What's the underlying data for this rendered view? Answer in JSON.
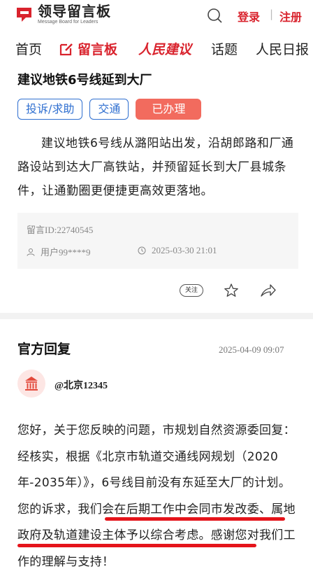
{
  "header": {
    "logo_cn": "领导留言板",
    "logo_en": "Message Board for Leaders",
    "login": "登录",
    "separator": "|",
    "register": "注册"
  },
  "nav": {
    "items": [
      "首页",
      "留言板",
      "人民建议",
      "话题",
      "人民日报"
    ]
  },
  "post": {
    "title": "建议地铁6号线延到大厂",
    "tags": [
      "投诉/求助",
      "交通"
    ],
    "status": "已办理",
    "body": "建议地铁6号线从潞阳站出发，沿胡郎路和厂通路设站到达大厂高铁站，并预留延长到大厂县城条件，让通勤圈更便捷更高效更落地。",
    "message_id": "留言ID:22740545",
    "user": "用户99****9",
    "time": "2025-03-30 21:01",
    "follow_label": "关注"
  },
  "reply": {
    "title": "官方回复",
    "date": "2025-04-09 09:07",
    "org": "@北京12345",
    "text_part1": "您好，关于您反映的问题，市规划自然资源委回复：经核实，根据《北京市轨道交通线网规划（2020年-2035年）》，6号线目前没有东延至大厂的计划。您的诉求，",
    "text_highlight": "我们会在后期工作中会同市发改委、属地政府及轨道建设主体予以综合考虑",
    "text_part2": "。感谢您对我们工作的理解与支持！"
  },
  "colors": {
    "accent": "#d9232d",
    "tag_blue": "#2f6fd0",
    "status_red": "#f26b5e",
    "underline": "#e5141b"
  }
}
